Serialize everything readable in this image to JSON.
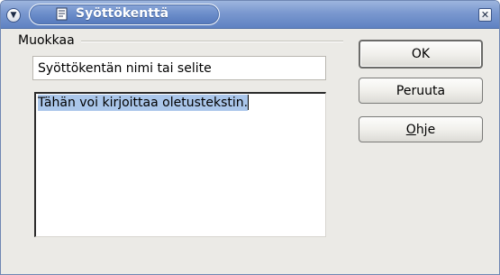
{
  "window": {
    "title": "Syöttökenttä",
    "accent": "#6a8cc9"
  },
  "icons": {
    "window_menu": "chevron-down-icon",
    "title": "document-icon",
    "close": "close-icon"
  },
  "group": {
    "label": "Muokkaa"
  },
  "fields": {
    "name_value": "Syöttökentän nimi tai selite",
    "text_value": "Tähän voi kirjoittaa oletustekstin."
  },
  "buttons": {
    "ok": "OK",
    "cancel": "Peruuta",
    "help_mnemonic": "O",
    "help_rest": "hje"
  }
}
